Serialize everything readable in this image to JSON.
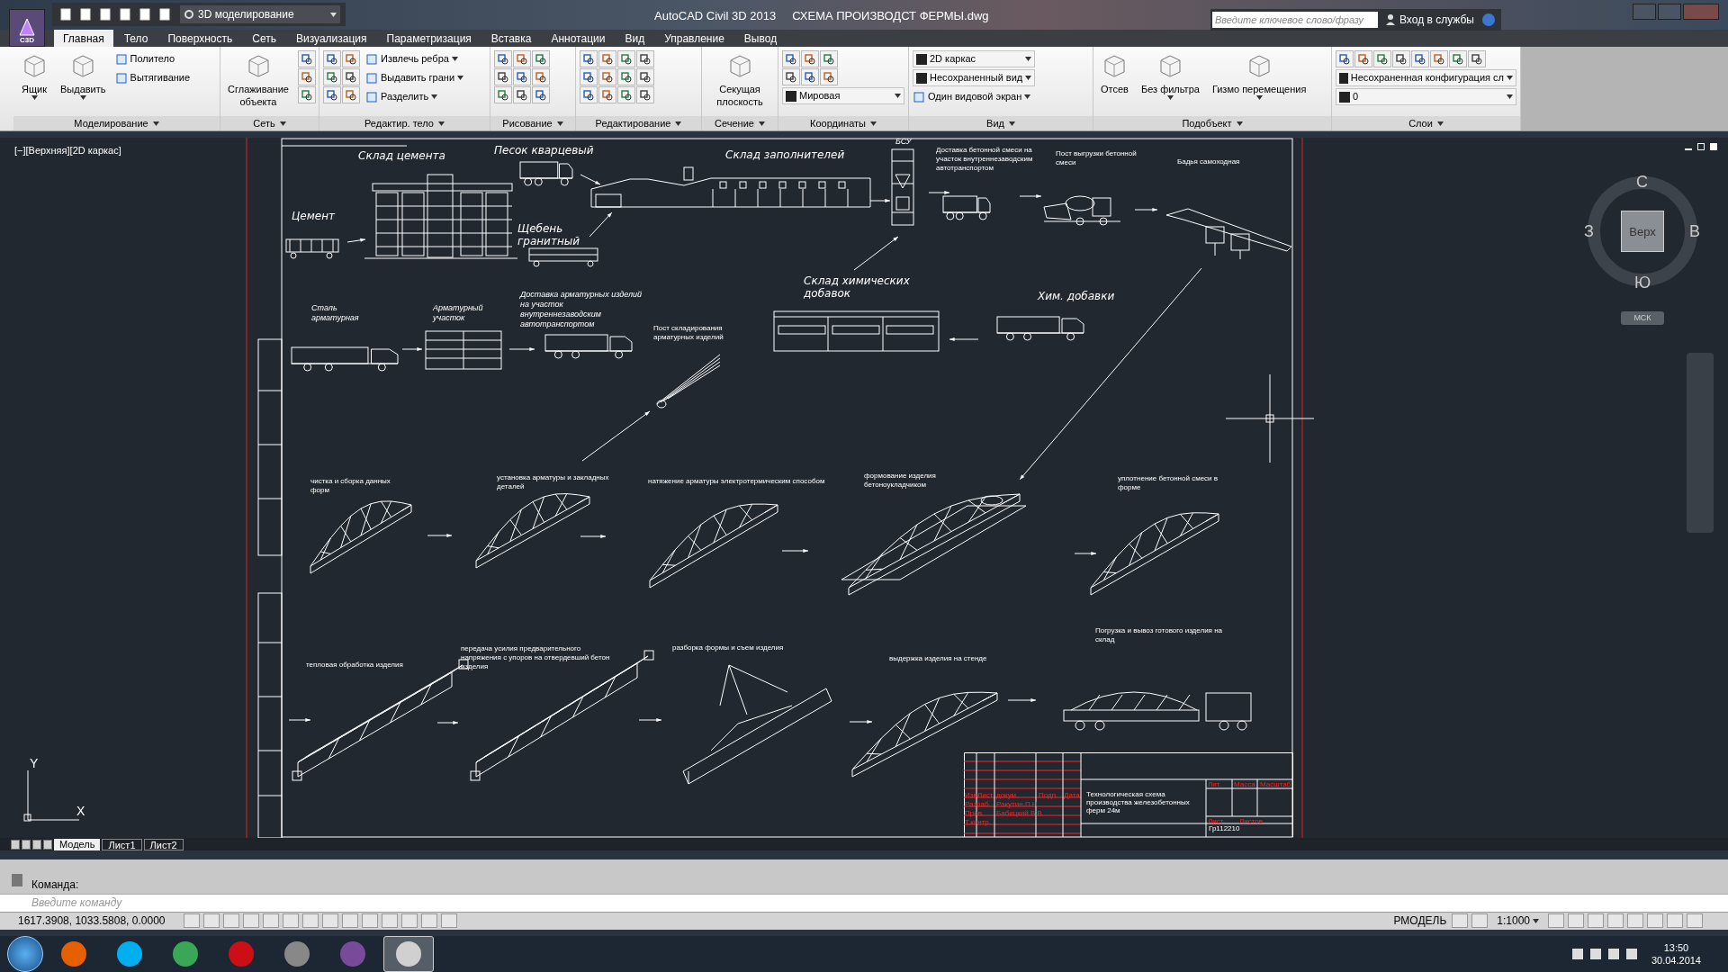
{
  "app_menu": {
    "badge": "C3D"
  },
  "quick_access": {
    "workspace": "3D моделирование"
  },
  "title": {
    "app": "AutoCAD Civil 3D 2013",
    "file": "СХЕМА ПРОИЗВОДСТ ФЕРМЫ.dwg"
  },
  "infocenter": {
    "search": {
      "placeholder": "Введите ключевое слово/фразу"
    },
    "sign_in": "Вход в службы"
  },
  "ribbon_tabs": [
    {
      "label": "Главная",
      "selected": true
    },
    {
      "label": "Тело",
      "selected": false
    },
    {
      "label": "Поверхность",
      "selected": false
    },
    {
      "label": "Сеть",
      "selected": false
    },
    {
      "label": "Визуализация",
      "selected": false
    },
    {
      "label": "Параметризация",
      "selected": false
    },
    {
      "label": "Вставка",
      "selected": false
    },
    {
      "label": "Аннотации",
      "selected": false
    },
    {
      "label": "Вид",
      "selected": false
    },
    {
      "label": "Управление",
      "selected": false
    },
    {
      "label": "Вывод",
      "selected": false
    }
  ],
  "ribbon_panels": [
    {
      "title": "Моделирование",
      "items": [
        {
          "kind": "large",
          "label": "Ящик",
          "caret": true
        },
        {
          "kind": "large",
          "label": "Выдавить",
          "caret": true
        },
        {
          "kind": "small",
          "label": "Политело",
          "caret": false
        },
        {
          "kind": "small",
          "label": "Вытягивание",
          "caret": false
        }
      ]
    },
    {
      "title": "Сеть",
      "items": [
        {
          "kind": "large",
          "label": "Сглаживание объекта",
          "caret": false
        }
      ]
    },
    {
      "title": "Редактир. тело",
      "items": [
        {
          "kind": "small",
          "label": "Извлечь ребра",
          "caret": true
        },
        {
          "kind": "small",
          "label": "Выдавить грани",
          "caret": true
        },
        {
          "kind": "small",
          "label": "Разделить",
          "caret": true
        }
      ]
    },
    {
      "title": "Рисование"
    },
    {
      "title": "Редактирование"
    },
    {
      "title": "Сечение",
      "items": [
        {
          "kind": "large",
          "label": "Секущая плоскость",
          "caret": false
        }
      ]
    },
    {
      "title": "Координаты",
      "items": [
        {
          "kind": "dropdown",
          "label": "Мировая"
        }
      ]
    },
    {
      "title": "Вид",
      "items": [
        {
          "kind": "dropdown",
          "label": "2D каркас"
        },
        {
          "kind": "dropdown",
          "label": "Несохраненный вид"
        },
        {
          "kind": "small",
          "label": "Один видовой экран",
          "caret": true
        }
      ]
    },
    {
      "title": "Подобъект",
      "items": [
        {
          "kind": "large",
          "label": "Отсев",
          "caret": false
        },
        {
          "kind": "large",
          "label": "Без фильтра",
          "caret": true
        },
        {
          "kind": "large",
          "label": "Гизмо перемещения",
          "caret": true
        }
      ]
    },
    {
      "title": "Слои",
      "items": [
        {
          "kind": "dropdown",
          "label": "Несохраненная конфигурация сл"
        },
        {
          "kind": "dropdown",
          "label": "0"
        }
      ]
    }
  ],
  "viewport": {
    "label": "[−][Верхняя][2D каркас]",
    "labels": [
      {
        "kind": "title",
        "text": "Склад цемента"
      },
      {
        "kind": "title",
        "text": "Песок кварцевый"
      },
      {
        "kind": "title",
        "text": "Склад заполнителей"
      },
      {
        "kind": "caption",
        "text": "БСУ"
      },
      {
        "kind": "note",
        "text": "Доставка бетонной смеси на участок внутреннезаводским автотранспортом"
      },
      {
        "kind": "note",
        "text": "Пост выгрузки бетонной смеси"
      },
      {
        "kind": "note",
        "text": "Бадья самоходная"
      },
      {
        "kind": "title",
        "text": "Цемент"
      },
      {
        "kind": "title",
        "text": "Щебень гранитный"
      },
      {
        "kind": "title",
        "text": "Склад химических добавок"
      },
      {
        "kind": "title",
        "text": "Хим. добавки"
      },
      {
        "kind": "caption",
        "text": "Сталь арматурная"
      },
      {
        "kind": "caption",
        "text": "Арматурный участок"
      },
      {
        "kind": "caption",
        "text": "Доставка арматурных изделий на участок внутреннезаводским автотранспортом"
      },
      {
        "kind": "note",
        "text": "Пост складирования арматурных изделий"
      },
      {
        "kind": "note",
        "text": "чистка и сборка данных форм"
      },
      {
        "kind": "note",
        "text": "установка арматуры и закладных деталей"
      },
      {
        "kind": "note",
        "text": "натяжение арматуры электротермическим способом"
      },
      {
        "kind": "note",
        "text": "формование изделия бетоноукладчиком"
      },
      {
        "kind": "note",
        "text": "уплотнение бетонной смеси в форме"
      },
      {
        "kind": "note",
        "text": "тепловая обработка изделия"
      },
      {
        "kind": "note",
        "text": "передача усилия предварительного напряжения с упоров на отвердевший бетон изделия"
      },
      {
        "kind": "note",
        "text": "разборка формы и съем изделия"
      },
      {
        "kind": "note",
        "text": "выдержка изделия на стенде"
      },
      {
        "kind": "note",
        "text": "Погрузка и вывоз готового изделия на склад"
      }
    ],
    "title_block": {
      "header": [
        "Изм",
        "Лист",
        "докум.",
        "Подп.",
        "Дата"
      ],
      "rows": [
        "Разраб.",
        "Пров.",
        "Т.контр."
      ],
      "names": [
        "Ракутин.П.Н",
        "Бабицкий.В.В"
      ],
      "description": "Технологическая схема производства железобетонных ферм 24м",
      "stage_headers": [
        "Лит.",
        "Масса",
        "Масштаб"
      ],
      "sheet": "Лист",
      "sheets": "Листов",
      "group": "Гр112210"
    },
    "view_cube": {
      "top": "Верх",
      "north": "С",
      "east": "В",
      "south": "Ю",
      "west": "З",
      "ucs": "МСК"
    },
    "ucs_axes": {
      "x": "X",
      "y": "Y"
    }
  },
  "layout_tabs": [
    {
      "label": "Модель",
      "selected": true
    },
    {
      "label": "Лист1",
      "selected": false
    },
    {
      "label": "Лист2",
      "selected": false
    }
  ],
  "command_line": {
    "history": "Команда:",
    "placeholder": "Введите команду"
  },
  "status_bar": {
    "coordinates": "1617.3908, 1033.5808, 0.0000",
    "space": "РМОДЕЛЬ",
    "scale": "1:1000"
  },
  "taskbar": {
    "apps": [
      {
        "kind": "firefox",
        "selected": false
      },
      {
        "kind": "skype",
        "selected": false
      },
      {
        "kind": "chrome",
        "selected": false
      },
      {
        "kind": "opera",
        "selected": false
      },
      {
        "kind": "game",
        "selected": false
      },
      {
        "kind": "player",
        "selected": false
      },
      {
        "kind": "autocad",
        "selected": true
      }
    ],
    "time": "13:50",
    "date": "30.04.2014"
  }
}
